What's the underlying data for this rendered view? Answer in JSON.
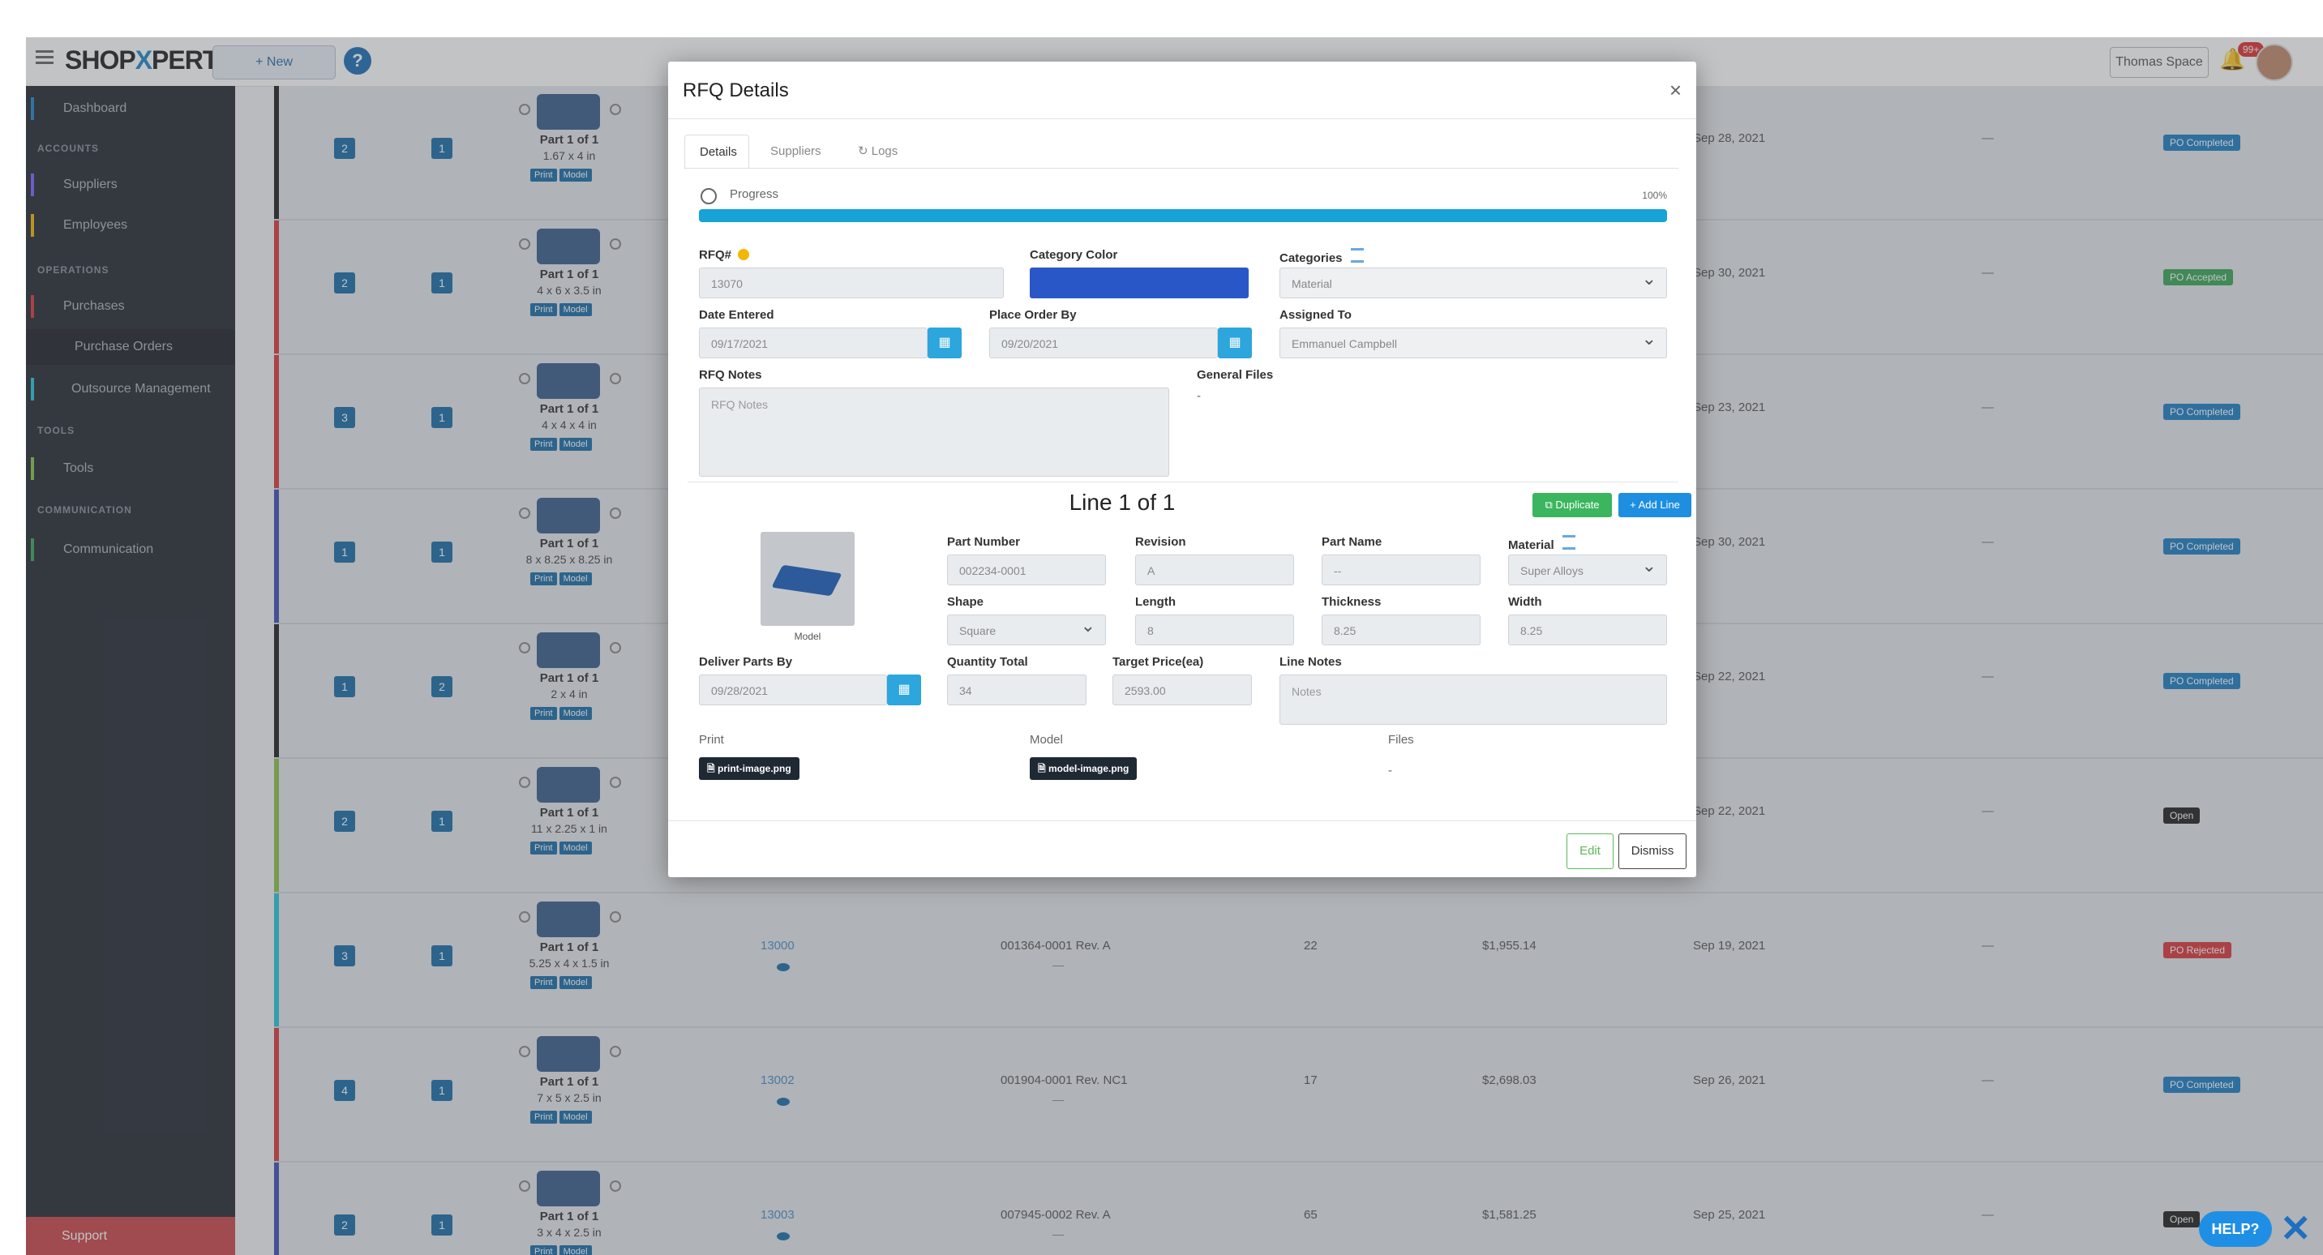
{
  "app": {
    "logo_part1": "SHOP",
    "logo_x": "X",
    "logo_part2": "PERT",
    "new_button": "+ New",
    "help_q": "?",
    "space_button": "Thomas Space",
    "notif_count": "99+",
    "help_button": "HELP?"
  },
  "sidebar": {
    "dashboard": "Dashboard",
    "accounts_head": "ACCOUNTS",
    "suppliers": "Suppliers",
    "employees": "Employees",
    "operations_head": "OPERATIONS",
    "purchases": "Purchases",
    "purchase_orders": "Purchase Orders",
    "outsource": "Outsource Management",
    "tools_head": "TOOLS",
    "tools": "Tools",
    "comm_head": "COMMUNICATION",
    "communication": "Communication",
    "support": "Support"
  },
  "rows": [
    {
      "edge": "#222222",
      "chk1": "2",
      "chk2": "1",
      "part": "Part 1 of 1",
      "dims": "1.67 x 4 in",
      "rfq": "",
      "partnum": "",
      "qty": "",
      "price": "",
      "date": "Sep 28, 2021",
      "status": "PO Completed",
      "status_color": "#1e7fc4"
    },
    {
      "edge": "#d9393c",
      "chk1": "2",
      "chk2": "1",
      "part": "Part 1 of 1",
      "dims": "4 x 6 x 3.5 in",
      "rfq": "",
      "partnum": "",
      "qty": "",
      "price": "",
      "date": "Sep 30, 2021",
      "status": "PO Accepted",
      "status_color": "#3aa655"
    },
    {
      "edge": "#d9393c",
      "chk1": "3",
      "chk2": "1",
      "part": "Part 1 of 1",
      "dims": "4 x 4 x 4 in",
      "rfq": "",
      "partnum": "",
      "qty": "",
      "price": "",
      "date": "Sep 23, 2021",
      "status": "PO Completed",
      "status_color": "#1e7fc4"
    },
    {
      "edge": "#3f51b5",
      "chk1": "1",
      "chk2": "1",
      "part": "Part 1 of 1",
      "dims": "8 x 8.25 x 8.25 in",
      "rfq": "",
      "partnum": "",
      "qty": "",
      "price": "",
      "date": "Sep 30, 2021",
      "status": "PO Completed",
      "status_color": "#1e7fc4"
    },
    {
      "edge": "#222222",
      "chk1": "1",
      "chk2": "2",
      "part": "Part 1 of 1",
      "dims": "2 x 4 in",
      "rfq": "",
      "partnum": "",
      "qty": "",
      "price": "",
      "date": "Sep 22, 2021",
      "status": "PO Completed",
      "status_color": "#1e7fc4"
    },
    {
      "edge": "#8bc34a",
      "chk1": "2",
      "chk2": "1",
      "part": "Part 1 of 1",
      "dims": "11 x 2.25 x 1 in",
      "rfq": "",
      "partnum": "",
      "qty": "",
      "price": "",
      "date": "Sep 22, 2021",
      "status": "Open",
      "status_color": "#222222"
    },
    {
      "edge": "#26c6da",
      "chk1": "3",
      "chk2": "1",
      "part": "Part 1 of 1",
      "dims": "5.25 x 4 x 1.5 in",
      "rfq": "13000",
      "partnum": "001364-0001 Rev. A",
      "qty": "22",
      "price": "$1,955.14",
      "date": "Sep 19, 2021",
      "status": "PO Rejected",
      "status_color": "#d9393c"
    },
    {
      "edge": "#d9393c",
      "chk1": "4",
      "chk2": "1",
      "part": "Part 1 of 1",
      "dims": "7 x 5 x 2.5 in",
      "rfq": "13002",
      "partnum": "001904-0001 Rev. NC1",
      "qty": "17",
      "price": "$2,698.03",
      "date": "Sep 26, 2021",
      "status": "PO Completed",
      "status_color": "#1e7fc4"
    },
    {
      "edge": "#3f51b5",
      "chk1": "2",
      "chk2": "1",
      "part": "Part 1 of 1",
      "dims": "3 x 4 x 2.5 in",
      "rfq": "13003",
      "partnum": "007945-0002 Rev. A",
      "qty": "65",
      "price": "$1,581.25",
      "date": "Sep 25, 2021",
      "status": "Open",
      "status_color": "#222222"
    }
  ],
  "tag_print": "Print",
  "tag_model": "Model",
  "modal": {
    "title": "RFQ Details",
    "close": "×",
    "tabs": [
      "Details",
      "Suppliers",
      "Logs"
    ],
    "progress_label": "Progress",
    "progress_pct": "100%",
    "progress_value": 100,
    "rfq_label": "RFQ#",
    "rfq_value": "13070",
    "category_color_label": "Category Color",
    "category_color": "#2a57c8",
    "categories_label": "Categories",
    "categories_value": "Material",
    "date_entered_label": "Date Entered",
    "date_entered_value": "09/17/2021",
    "place_order_label": "Place Order By",
    "place_order_value": "09/20/2021",
    "assigned_label": "Assigned To",
    "assigned_value": "Emmanuel Campbell",
    "rfq_notes_label": "RFQ Notes",
    "rfq_notes_placeholder": "RFQ Notes",
    "general_files_label": "General Files",
    "general_files_value": "-",
    "line_title": "Line 1 of 1",
    "duplicate": "Duplicate",
    "add_line": "+ Add Line",
    "model_caption": "Model",
    "part_number_label": "Part Number",
    "part_number_value": "002234-0001",
    "revision_label": "Revision",
    "revision_value": "A",
    "part_name_label": "Part Name",
    "part_name_value": "--",
    "material_label": "Material",
    "material_value": "Super Alloys",
    "shape_label": "Shape",
    "shape_value": "Square",
    "length_label": "Length",
    "length_value": "8",
    "thickness_label": "Thickness",
    "thickness_value": "8.25",
    "width_label": "Width",
    "width_value": "8.25",
    "deliver_label": "Deliver Parts By",
    "deliver_value": "09/28/2021",
    "qty_label": "Quantity Total",
    "qty_value": "34",
    "target_label": "Target Price(ea)",
    "target_value": "2593.00",
    "line_notes_label": "Line Notes",
    "line_notes_placeholder": "Notes",
    "print_label": "Print",
    "print_file": "print-image.png",
    "model_label": "Model",
    "model_file": "model-image.png",
    "files_label": "Files",
    "files_value": "-",
    "edit": "Edit",
    "dismiss": "Dismiss"
  }
}
